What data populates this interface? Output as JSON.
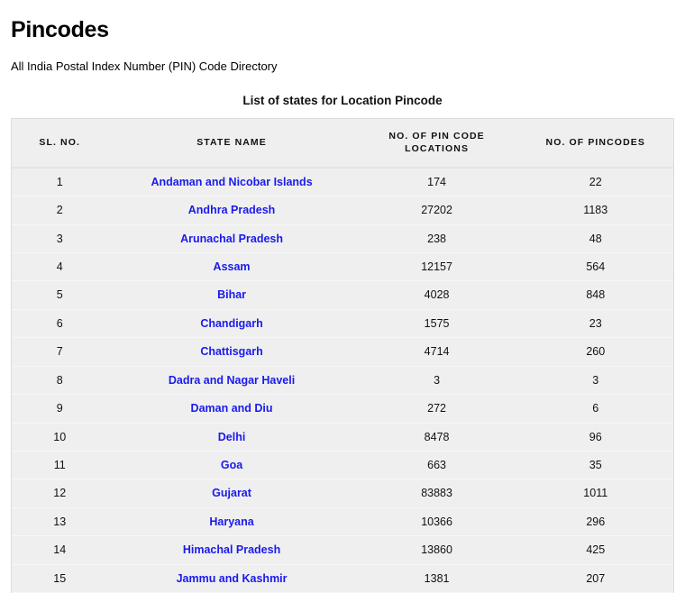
{
  "header": {
    "title": "Pincodes",
    "subtitle": "All India Postal Index Number (PIN) Code Directory"
  },
  "table": {
    "caption": "List of states for Location Pincode",
    "columns": [
      "SL. NO.",
      "STATE NAME",
      "NO. OF PIN CODE LOCATIONS",
      "NO. OF PINCODES"
    ],
    "link_color": "#1a1aee",
    "rows": [
      {
        "sl": "1",
        "state": "Andaman and Nicobar Islands",
        "locations": "174",
        "pincodes": "22"
      },
      {
        "sl": "2",
        "state": "Andhra Pradesh",
        "locations": "27202",
        "pincodes": "1183"
      },
      {
        "sl": "3",
        "state": "Arunachal Pradesh",
        "locations": "238",
        "pincodes": "48"
      },
      {
        "sl": "4",
        "state": "Assam",
        "locations": "12157",
        "pincodes": "564"
      },
      {
        "sl": "5",
        "state": "Bihar",
        "locations": "4028",
        "pincodes": "848"
      },
      {
        "sl": "6",
        "state": "Chandigarh",
        "locations": "1575",
        "pincodes": "23"
      },
      {
        "sl": "7",
        "state": "Chattisgarh",
        "locations": "4714",
        "pincodes": "260"
      },
      {
        "sl": "8",
        "state": "Dadra and Nagar Haveli",
        "locations": "3",
        "pincodes": "3"
      },
      {
        "sl": "9",
        "state": "Daman and Diu",
        "locations": "272",
        "pincodes": "6"
      },
      {
        "sl": "10",
        "state": "Delhi",
        "locations": "8478",
        "pincodes": "96"
      },
      {
        "sl": "11",
        "state": "Goa",
        "locations": "663",
        "pincodes": "35"
      },
      {
        "sl": "12",
        "state": "Gujarat",
        "locations": "83883",
        "pincodes": "1011"
      },
      {
        "sl": "13",
        "state": "Haryana",
        "locations": "10366",
        "pincodes": "296"
      },
      {
        "sl": "14",
        "state": "Himachal Pradesh",
        "locations": "13860",
        "pincodes": "425"
      },
      {
        "sl": "15",
        "state": "Jammu and Kashmir",
        "locations": "1381",
        "pincodes": "207"
      }
    ]
  }
}
